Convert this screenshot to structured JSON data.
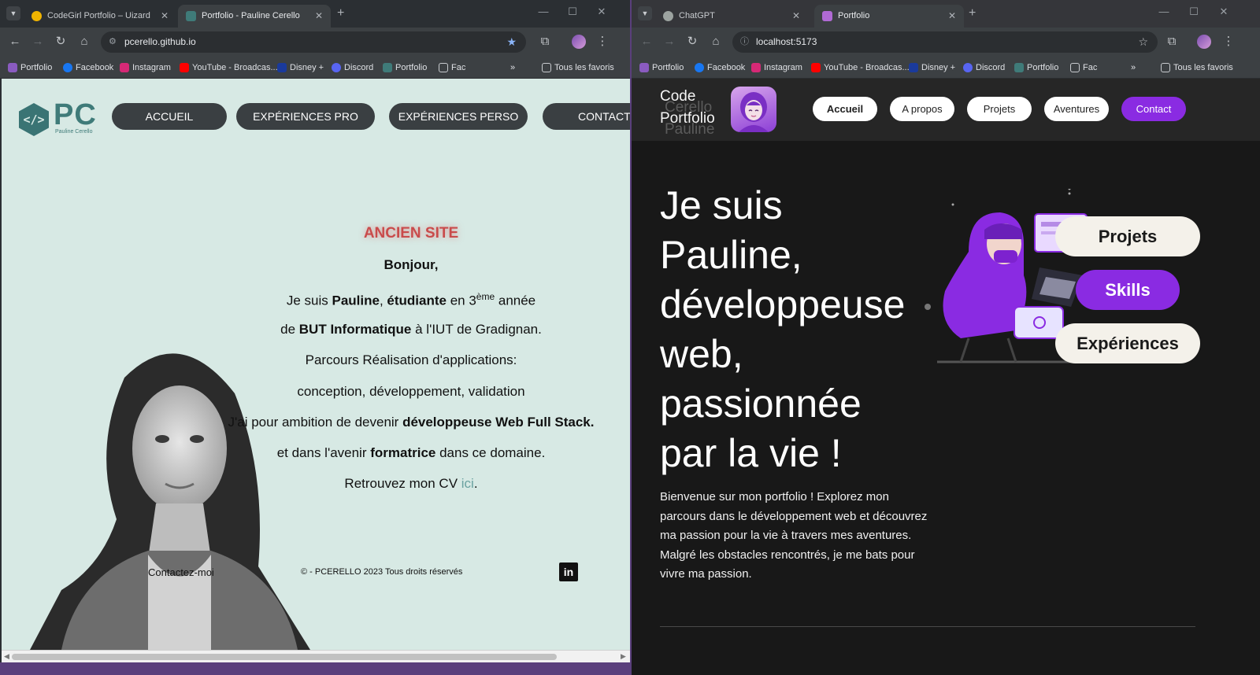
{
  "left_window": {
    "tabs": [
      {
        "title": "CodeGirl Portfolio – Uizard",
        "active": false
      },
      {
        "title": "Portfolio - Pauline Cerello",
        "active": true
      }
    ],
    "url": "pcerello.github.io",
    "bookmarks": [
      "Portfolio",
      "Facebook",
      "Instagram",
      "YouTube - Broadcas...",
      "Disney +",
      "Discord",
      "Portfolio",
      "Fac"
    ],
    "bookmarks_more": "»",
    "all_bookmarks": "Tous les favoris"
  },
  "right_window": {
    "tabs": [
      {
        "title": "ChatGPT",
        "active": false
      },
      {
        "title": "Portfolio",
        "active": true
      }
    ],
    "url": "localhost:5173",
    "bookmarks": [
      "Portfolio",
      "Facebook",
      "Instagram",
      "YouTube - Broadcas...",
      "Disney +",
      "Discord",
      "Portfolio",
      "Fac"
    ],
    "bookmarks_more": "»",
    "all_bookmarks": "Tous les favoris"
  },
  "old_site": {
    "logo_text": "PC",
    "logo_subtitle": "Pauline Cerello",
    "nav": [
      "ACCUEIL",
      "EXPÉRIENCES PRO",
      "EXPÉRIENCES PERSO",
      "CONTACT"
    ],
    "banner": "ANCIEN SITE",
    "greeting": "Bonjour,",
    "line1_a": "Je suis ",
    "line1_name": "Pauline",
    "line1_b": ", ",
    "line1_role": "étudiante",
    "line1_c": " en 3",
    "line1_sup": "ème",
    "line1_d": " année",
    "line2_a": "de ",
    "line2_bold": "BUT Informatique",
    "line2_b": " à l'IUT de Gradignan.",
    "line3": "Parcours Réalisation d'applications:",
    "line4": "conception, développement, validation",
    "line5_a": "J'ai pour ambition de devenir ",
    "line5_bold": "développeuse Web Full Stack.",
    "line6_a": "et dans l'avenir ",
    "line6_bold": "formatrice",
    "line6_b": " dans ce domaine.",
    "line7_a": "Retrouvez mon CV ",
    "line7_link": "ici",
    "line7_b": ".",
    "contact": "Contactez-moi",
    "copyright": "© - PCERELLO 2023 Tous droits réservés",
    "linkedin_icon": "in"
  },
  "new_site": {
    "brand_line1": "Code",
    "brand_line2": "Portfolio",
    "brand_ghost1": "Cerello",
    "brand_ghost2": "Pauline",
    "nav": [
      "Accueil",
      "A propos",
      "Projets",
      "Aventures",
      "Contact"
    ],
    "hero_lines": [
      "Je suis",
      "Pauline,",
      "développeuse",
      "web,",
      "passionnée",
      "par la vie !"
    ],
    "hero_text": "Bienvenue sur mon portfolio ! Explorez mon parcours dans le développement web et découvrez ma passion pour la vie à travers mes aventures. Malgré les obstacles rencontrés, je me bats pour vivre ma passion.",
    "pills": [
      "Projets",
      "Skills",
      "Expériences"
    ]
  },
  "colors": {
    "old_bg": "#d7e9e4",
    "old_accent": "#3f7b79",
    "old_banner": "#c94b4b",
    "new_bg": "#181818",
    "new_accent": "#8a2be2"
  }
}
